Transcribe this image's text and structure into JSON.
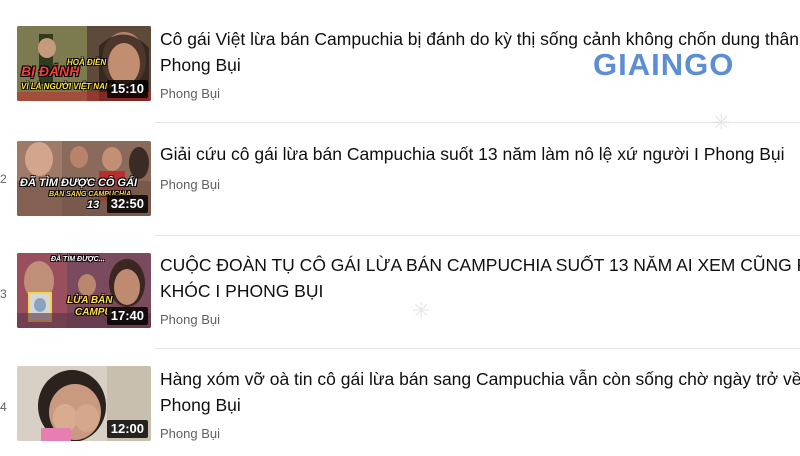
{
  "watermark": {
    "text": "GIAINGO",
    "color": "#4a82d0"
  },
  "videos": [
    {
      "index": "",
      "title_lines": [
        "Cô gái Việt lừa bán Campuchia bị đánh do kỳ thị sống cảnh không chốn dung thân",
        "Phong Bụi"
      ],
      "channel": "Phong Bụi",
      "duration": "15:10",
      "thumb_caption_1": "BỊ ĐÁNH",
      "thumb_caption_2": "VÌ LÀ NGƯỜI VIỆT NAM",
      "thumb_caption_3": "HOÀ ĐIỀN"
    },
    {
      "index": "2",
      "title_lines": [
        "Giải cứu cô gái lừa bán Campuchia suốt 13 năm làm nô lệ xứ người I Phong Bụi"
      ],
      "channel": "Phong Bụi",
      "duration": "32:50",
      "thumb_caption_1": "ĐÃ TÌM ĐƯỢC CÔ GÁI",
      "thumb_caption_2": "BÁN SANG CAMPUCHIA",
      "thumb_caption_3": "13"
    },
    {
      "index": "3",
      "title_lines": [
        "CUỘC ĐOÀN TỤ CÔ GÁI LỪA BÁN CAMPUCHIA SUỐT 13 NĂM AI XEM CŨNG PHẢI",
        "KHÓC I PHONG BỤI"
      ],
      "channel": "Phong Bụi",
      "duration": "17:40",
      "thumb_caption_1": "ĐÃ TÌM ĐƯỢC...",
      "thumb_caption_2": "LỪA BÁN",
      "thumb_caption_3": "CAMPU"
    },
    {
      "index": "4",
      "title_lines": [
        "Hàng xóm vỡ oà tin cô gái lừa bán sang Campuchia vẫn còn sống chờ ngày trở về",
        "Phong Bụi"
      ],
      "channel": "Phong Bụi",
      "duration": "12:00",
      "thumb_caption_1": "",
      "thumb_caption_2": "",
      "thumb_caption_3": ""
    }
  ]
}
